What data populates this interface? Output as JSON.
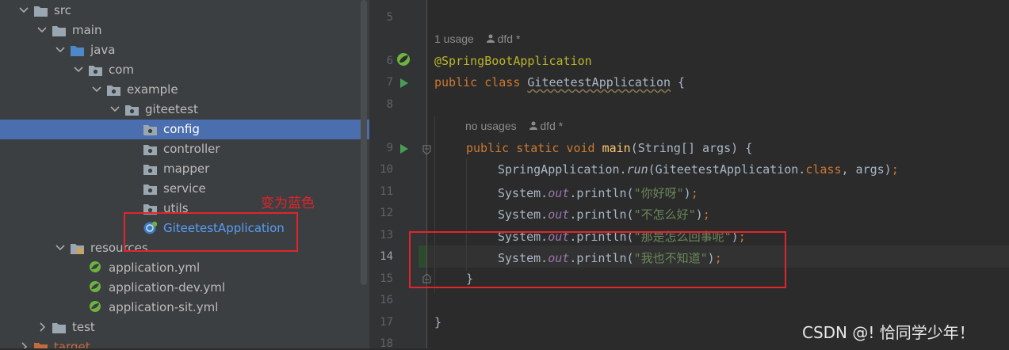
{
  "project_tree": {
    "items": [
      {
        "label": "src",
        "kind": "folder",
        "expanded": true,
        "selected": false
      },
      {
        "label": "main",
        "kind": "folder",
        "expanded": true,
        "selected": false
      },
      {
        "label": "java",
        "kind": "source-folder",
        "expanded": true,
        "selected": false
      },
      {
        "label": "com",
        "kind": "package",
        "expanded": true,
        "selected": false
      },
      {
        "label": "example",
        "kind": "package",
        "expanded": true,
        "selected": false
      },
      {
        "label": "giteetest",
        "kind": "package",
        "expanded": true,
        "selected": false
      },
      {
        "label": "config",
        "kind": "package",
        "selected": true
      },
      {
        "label": "controller",
        "kind": "package",
        "selected": false
      },
      {
        "label": "mapper",
        "kind": "package",
        "selected": false
      },
      {
        "label": "service",
        "kind": "package",
        "selected": false
      },
      {
        "label": "utils",
        "kind": "package",
        "selected": false
      },
      {
        "label": "GiteetestApplication",
        "kind": "spring-class",
        "selected": false,
        "color": "#589df6"
      },
      {
        "label": "resources",
        "kind": "resources-folder",
        "expanded": true,
        "selected": false
      },
      {
        "label": "application.yml",
        "kind": "spring-yml",
        "selected": false
      },
      {
        "label": "application-dev.yml",
        "kind": "spring-yml",
        "selected": false
      },
      {
        "label": "application-sit.yml",
        "kind": "spring-yml",
        "selected": false
      },
      {
        "label": "test",
        "kind": "folder",
        "expanded": false,
        "selected": false
      },
      {
        "label": "target",
        "kind": "excluded-folder",
        "expanded": false,
        "selected": false
      }
    ]
  },
  "annotation": {
    "text": "变为蓝色",
    "color": "#e0252b"
  },
  "editor": {
    "line_numbers": [
      "5",
      "6",
      "7",
      "8",
      "9",
      "10",
      "11",
      "12",
      "13",
      "14",
      "15",
      "16",
      "17",
      "18"
    ],
    "current_line": "14",
    "hints": {
      "class_usage": "1 usage",
      "class_author": "dfd *",
      "method_usage": "no usages",
      "method_author": "dfd *"
    },
    "code": {
      "annotation": "@SpringBootApplication",
      "kw_public": "public",
      "kw_class": "class",
      "class_name": "GiteetestApplication",
      "brace_open": " {",
      "kw_static": "static",
      "kw_void": "void",
      "method_name": "main",
      "params": "(String[] args) {",
      "spring_app": "SpringApplication.",
      "run": "run",
      "run_args_a": "(GiteetestApplication.",
      "kw_class_lit": "class",
      "run_args_b": ", args)",
      "semicolon": ";",
      "system": "System.",
      "out": "out",
      "println": ".println(",
      "close_paren": ")",
      "strings": [
        "\"你好呀\"",
        "\"不怎么好\"",
        "\"那是怎么回事呢\"",
        "\"我也不知道\""
      ],
      "method_close": "}",
      "class_close": "}"
    }
  },
  "watermark": "CSDN @! 恰同学少年！"
}
